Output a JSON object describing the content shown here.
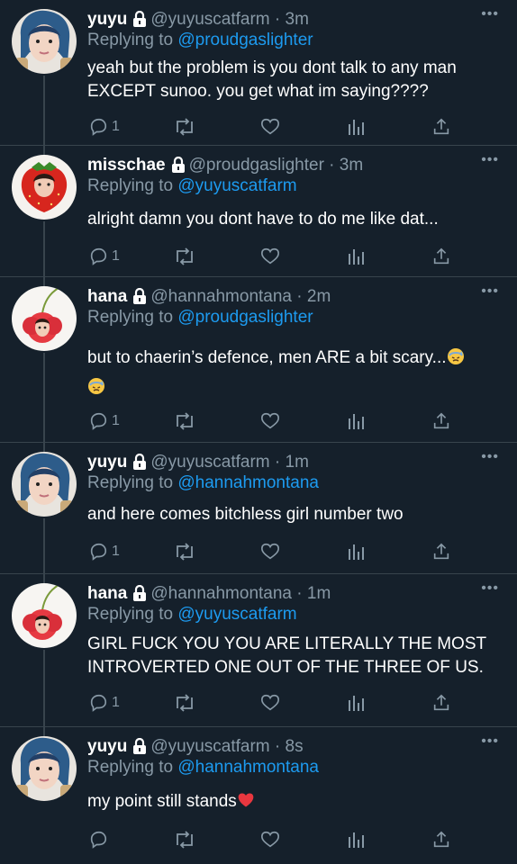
{
  "tweets": [
    {
      "name": "yuyu",
      "handle": "@yuyuscatfarm",
      "dot": "·",
      "time": "3m",
      "reply_prefix": "Replying to",
      "reply_to": "@proudgaslighter",
      "lines": [
        "yeah but the problem is you dont talk to any man",
        "EXCEPT sunoo. you get what im saying????"
      ],
      "reply_count": "1",
      "avatar": "avatar-yuyu"
    },
    {
      "name": "misschae",
      "handle": "@proudgaslighter",
      "dot": "·",
      "time": "3m",
      "reply_prefix": "Replying to",
      "reply_to": "@yuyuscatfarm",
      "lines": [
        "alright damn you dont have to do me like dat..."
      ],
      "reply_count": "1",
      "avatar": "avatar-strawberry"
    },
    {
      "name": "hana",
      "handle": "@hannahmontana",
      "dot": "·",
      "time": "2m",
      "reply_prefix": "Replying to",
      "reply_to": "@proudgaslighter",
      "lines": [
        "but to chaerin’s defence, men ARE a bit scary..."
      ],
      "reply_count": "1",
      "avatar": "avatar-cherry"
    },
    {
      "name": "yuyu",
      "handle": "@yuyuscatfarm",
      "dot": "·",
      "time": "1m",
      "reply_prefix": "Replying to",
      "reply_to": "@hannahmontana",
      "lines": [
        "and here comes bitchless girl number two"
      ],
      "reply_count": "1",
      "avatar": "avatar-yuyu"
    },
    {
      "name": "hana",
      "handle": "@hannahmontana",
      "dot": "·",
      "time": "1m",
      "reply_prefix": "Replying to",
      "reply_to": "@yuyuscatfarm",
      "lines": [
        "GIRL FUCK YOU YOU ARE LITERALLY THE MOST",
        "INTROVERTED ONE OUT OF THE THREE OF US."
      ],
      "reply_count": "1",
      "avatar": "avatar-cherry"
    },
    {
      "name": "yuyu",
      "handle": "@yuyuscatfarm",
      "dot": "·",
      "time": "8s",
      "reply_prefix": "Replying to",
      "reply_to": "@hannahmontana",
      "lines": [
        "my point still stands"
      ],
      "reply_count": "",
      "avatar": "avatar-yuyu"
    }
  ],
  "icons": {
    "reply": "reply-icon",
    "retweet": "retweet-icon",
    "like": "heart-icon",
    "analytics": "analytics-icon",
    "share": "share-icon",
    "more": "more-icon",
    "lock": "lock-icon",
    "sweat_emoji": "downcast-sweat-face-emoji",
    "heart_emoji": "red-heart-emoji"
  },
  "colors": {
    "background": "#15202b",
    "muted": "#8899a6",
    "link": "#1d9bf0",
    "divider": "#38444d"
  }
}
